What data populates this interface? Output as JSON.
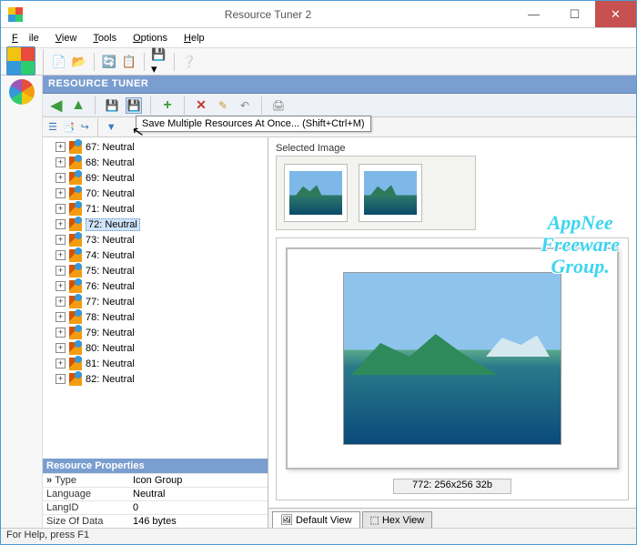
{
  "window": {
    "title": "Resource Tuner 2"
  },
  "window_controls": {
    "min": "—",
    "max": "☐",
    "close": "✕"
  },
  "menu": {
    "file": "File",
    "view": "View",
    "tools": "Tools",
    "options": "Options",
    "help": "Help"
  },
  "header": {
    "title": "RESOURCE TUNER"
  },
  "tooltip": "Save Multiple Resources At Once... (Shift+Ctrl+M)",
  "tree": {
    "items": [
      {
        "label": "67: Neutral"
      },
      {
        "label": "68: Neutral"
      },
      {
        "label": "69: Neutral"
      },
      {
        "label": "70: Neutral"
      },
      {
        "label": "71: Neutral"
      },
      {
        "label": "72: Neutral",
        "selected": true
      },
      {
        "label": "73: Neutral"
      },
      {
        "label": "74: Neutral"
      },
      {
        "label": "75: Neutral"
      },
      {
        "label": "76: Neutral"
      },
      {
        "label": "77: Neutral"
      },
      {
        "label": "78: Neutral"
      },
      {
        "label": "79: Neutral"
      },
      {
        "label": "80: Neutral"
      },
      {
        "label": "81: Neutral"
      },
      {
        "label": "82: Neutral"
      }
    ]
  },
  "props": {
    "header": "Resource Properties",
    "rows": [
      {
        "k": "Type",
        "v": "Icon Group"
      },
      {
        "k": "Language",
        "v": "Neutral"
      },
      {
        "k": "LangID",
        "v": "0"
      },
      {
        "k": "Size Of Data",
        "v": "146 bytes"
      }
    ]
  },
  "preview": {
    "selected_label": "Selected Image",
    "caption": "772: 256x256 32b",
    "tabs": {
      "default": "Default View",
      "hex": "Hex View"
    }
  },
  "status": "For Help, press F1",
  "watermark": {
    "l1": "AppNee",
    "l2": "Freeware",
    "l3": "Group."
  }
}
